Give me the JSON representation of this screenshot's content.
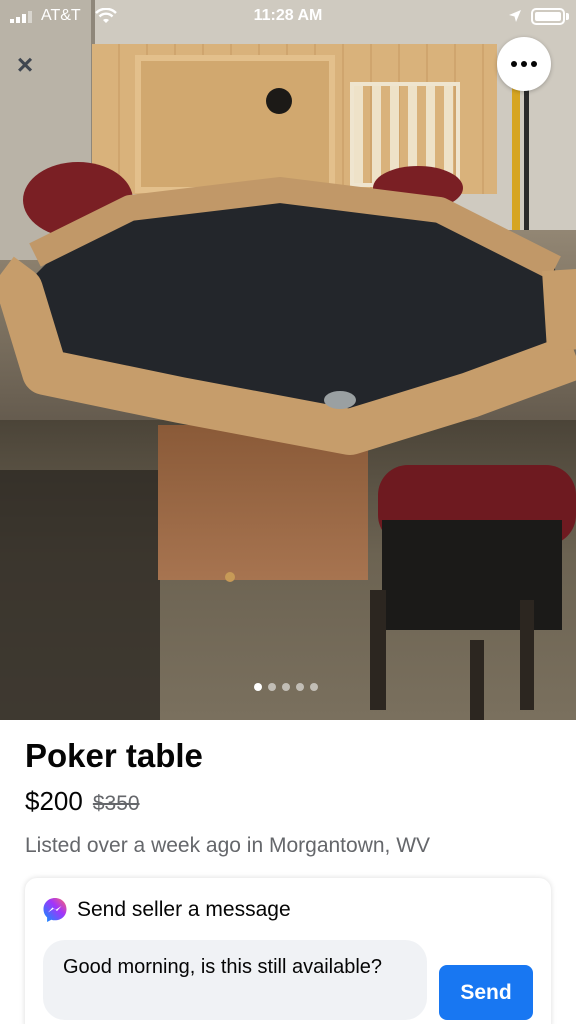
{
  "status_bar": {
    "carrier": "AT&T",
    "time": "11:28 AM"
  },
  "photo": {
    "image_count": 5,
    "active_index": 0,
    "close_icon": "close-icon",
    "more_icon": "more-horizontal-icon"
  },
  "listing": {
    "title": "Poker table",
    "price": "$200",
    "original_price": "$350",
    "listed": "Listed over a week ago in Morgantown, WV"
  },
  "message": {
    "heading": "Send seller a message",
    "input_value": "Good morning, is this still available?",
    "send_label": "Send",
    "icon": "messenger-icon"
  },
  "colors": {
    "accent": "#1877f2",
    "secondary_text": "#65676b",
    "input_bg": "#f0f2f5"
  }
}
